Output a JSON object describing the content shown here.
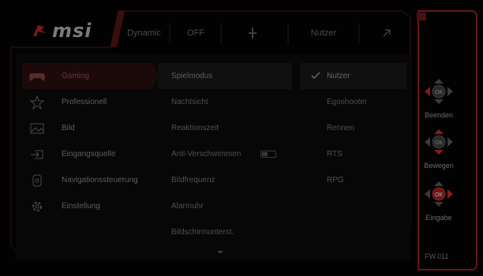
{
  "brand": {
    "logo_text": "msi"
  },
  "header": {
    "items": [
      {
        "label": "Dynamic",
        "name": "header-item-1"
      },
      {
        "label": "OFF",
        "name": "header-item-2"
      },
      {
        "label": "",
        "name": "header-item-3"
      },
      {
        "label": "Nutzer",
        "name": "header-item-4"
      },
      {
        "label": "",
        "name": "header-item-5"
      }
    ]
  },
  "menu": {
    "items": [
      {
        "label": "Gaming",
        "icon": "gamepad-icon",
        "active": true
      },
      {
        "label": "Professionell",
        "icon": "star-icon",
        "active": false
      },
      {
        "label": "Bild",
        "icon": "image-icon",
        "active": false
      },
      {
        "label": "Eingangsquelle",
        "icon": "input-source-icon",
        "active": false
      },
      {
        "label": "Navigationssteuerung",
        "icon": "navigation-icon",
        "active": false
      },
      {
        "label": "Einstellung",
        "icon": "gear-icon",
        "active": false
      }
    ]
  },
  "submenu": {
    "items": [
      {
        "label": "Spielmodus",
        "active": true
      },
      {
        "label": "Nachtsicht",
        "active": false
      },
      {
        "label": "Reaktionszeit",
        "active": false
      },
      {
        "label": "Anti-Verschwimmen",
        "active": false,
        "has_toggle": true
      },
      {
        "label": "Bildfrequenz",
        "active": false
      },
      {
        "label": "Alarmuhr",
        "active": false
      },
      {
        "label": "Bildschirmunterst.",
        "active": false
      }
    ]
  },
  "options": {
    "items": [
      {
        "label": "Nutzer",
        "selected": true
      },
      {
        "label": "Egoshooter",
        "selected": false
      },
      {
        "label": "Rennen",
        "selected": false
      },
      {
        "label": "RTS",
        "selected": false
      },
      {
        "label": "RPG",
        "selected": false
      }
    ]
  },
  "controls": [
    {
      "label": "Beenden",
      "center": "OK",
      "icon": "dpad-exit-icon"
    },
    {
      "label": "Bewegen",
      "center": "OK",
      "icon": "dpad-move-icon"
    },
    {
      "label": "Eingabe",
      "center": "OK",
      "icon": "dpad-enter-icon"
    }
  ],
  "firmware": "FW.011",
  "colors": {
    "accent": "#8a1a1a",
    "frame": "#5a1212"
  }
}
